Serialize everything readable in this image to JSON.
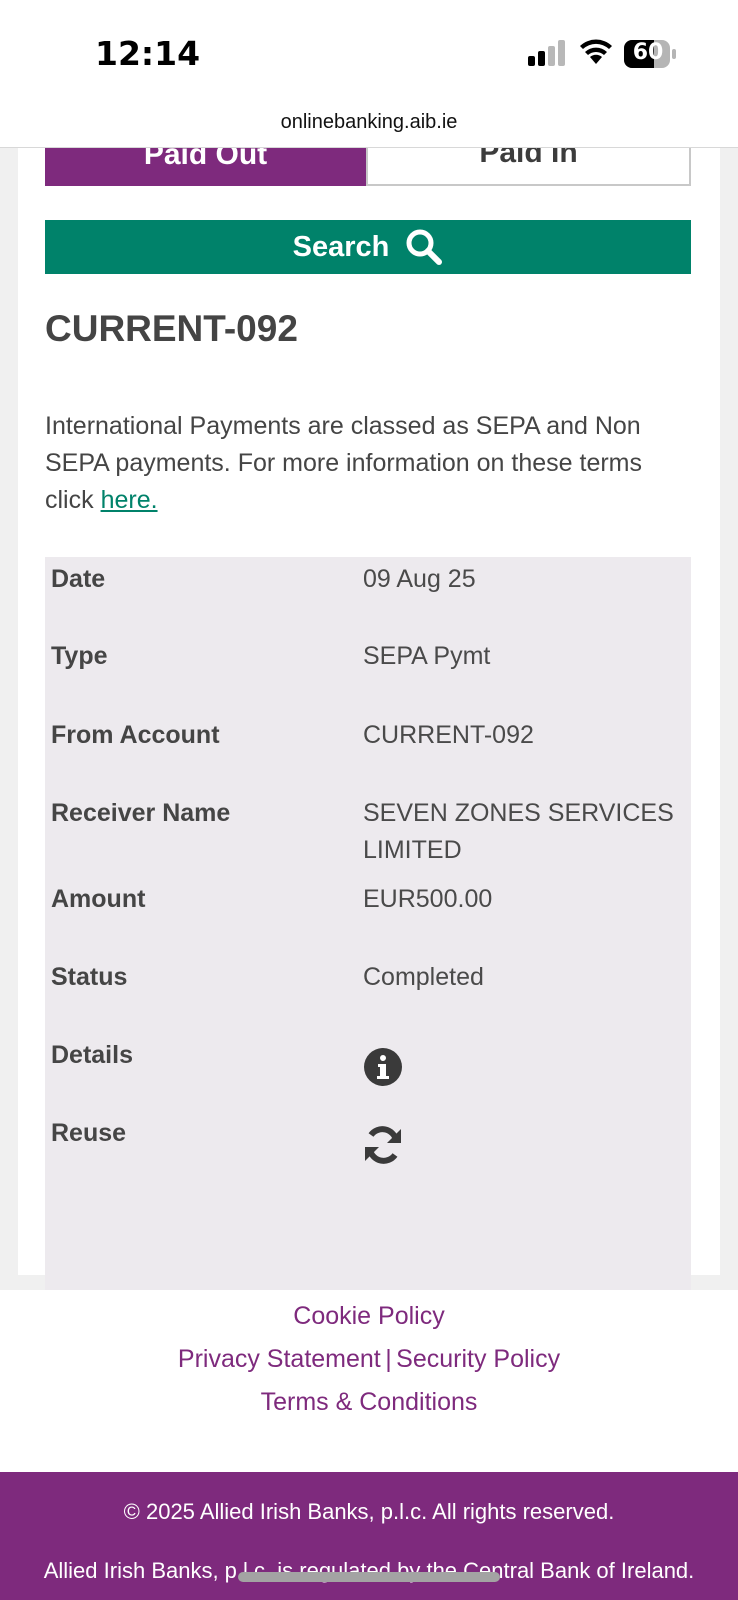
{
  "status_bar": {
    "time": "12:14",
    "battery_level": "60"
  },
  "browser": {
    "url": "onlinebanking.aib.ie"
  },
  "tabs": [
    {
      "label": "Paid Out",
      "active": true
    },
    {
      "label": "Paid In",
      "active": false
    }
  ],
  "search": {
    "label": "Search",
    "icon": "search-icon"
  },
  "account_title": "CURRENT-092",
  "info": {
    "text": "International Payments are classed as SEPA and Non SEPA payments. For more information on these terms click",
    "link_text": "here."
  },
  "transaction": {
    "date_label": "Date",
    "date_value": "09 Aug 25",
    "type_label": "Type",
    "type_value": "SEPA Pymt",
    "from_label": "From Account",
    "from_value": "CURRENT-092",
    "receiver_label": "Receiver Name",
    "receiver_value": "SEVEN ZONES SERVICES LIMITED",
    "amount_label": "Amount",
    "amount_value": "EUR500.00",
    "status_label": "Status",
    "status_value": "Completed",
    "details_label": "Details",
    "details_icon": "info-circle-icon",
    "reuse_label": "Reuse",
    "reuse_icon": "refresh-icon"
  },
  "footer": {
    "cookie_policy": "Cookie Policy",
    "privacy_statement": "Privacy Statement",
    "separator": "|",
    "security_policy": "Security Policy",
    "terms": "Terms & Conditions",
    "copyright": "© 2025 Allied Irish Banks, p.l.c. All rights reserved.",
    "regulated": "Allied Irish Banks, p.l.c. is regulated by the Central Bank of Ireland."
  },
  "colors": {
    "brand_purple": "#7e2a7d",
    "search_green": "#00826a",
    "table_bg": "#edeaee"
  }
}
